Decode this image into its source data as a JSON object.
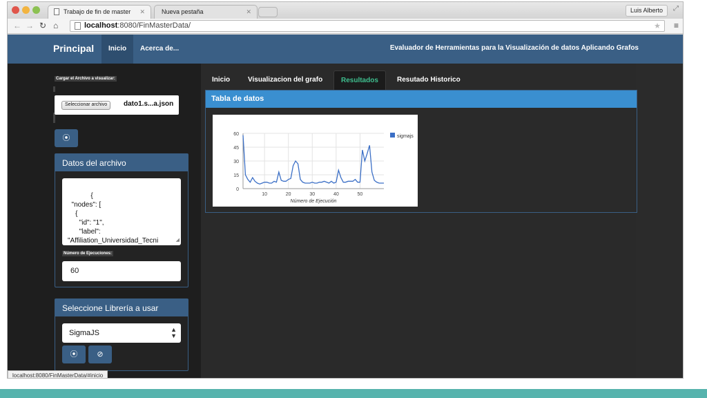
{
  "browser": {
    "tabs": [
      {
        "label": "Trabajo de fin de master"
      },
      {
        "label": "Nueva pestaña"
      }
    ],
    "user": "Luis Alberto",
    "url_host": "localhost",
    "url_rest": ":8080/FinMasterData/",
    "status_url": "localhost:8080/FinMasterData/#inicio"
  },
  "navbar": {
    "brand": "Principal",
    "links": [
      "Inicio",
      "Acerca de..."
    ],
    "title": "Evaluador de Herramientas para la Visualización de datos Aplicando Grafos"
  },
  "sidebar": {
    "upload_label": "Cargar el Archivo a visualizar:",
    "file_button": "Seleccionar archivo",
    "file_name": "dato1.s...a.json",
    "datos_title": "Datos del archivo",
    "json_text": "{\n  \"nodes\": [\n    {\n      \"id\": \"1\",\n      \"label\":\n\"Affiliation_Universidad_Tecni\nca_Particular_de_Loja\"",
    "exec_label": "Número de Ejecuciones:",
    "exec_value": "60",
    "lib_title": "Seleccione Librería a usar",
    "lib_value": "SigmaJS"
  },
  "content": {
    "tabs": [
      "Inicio",
      "Visualizacion del grafo",
      "Resultados",
      "Resutado Historico"
    ],
    "active_tab": "Resultados",
    "panel_title": "Tabla de datos"
  },
  "colors": {
    "navbar": "#3a5f85",
    "accent_tab": "#3fbf8f",
    "panel_head": "#3a8fd0",
    "series": "#3b6fc6"
  },
  "chart_data": {
    "type": "line",
    "xlabel": "Número de Ejecución",
    "ylabel": "",
    "xlim": [
      1,
      60
    ],
    "ylim": [
      0,
      60
    ],
    "xticks": [
      10,
      20,
      30,
      40,
      50
    ],
    "yticks": [
      0,
      15,
      30,
      45,
      60
    ],
    "grid": true,
    "legend": "top-right",
    "series": [
      {
        "name": "sigmajs",
        "x": [
          1,
          2,
          3,
          4,
          5,
          6,
          7,
          8,
          9,
          10,
          11,
          12,
          13,
          14,
          15,
          16,
          17,
          18,
          19,
          20,
          21,
          22,
          23,
          24,
          25,
          26,
          27,
          28,
          29,
          30,
          31,
          32,
          33,
          34,
          35,
          36,
          37,
          38,
          39,
          40,
          41,
          42,
          43,
          44,
          45,
          46,
          47,
          48,
          49,
          50,
          51,
          52,
          53,
          54,
          55,
          56,
          57,
          58,
          59,
          60
        ],
        "values": [
          58,
          15,
          10,
          7,
          12,
          8,
          6,
          5,
          6,
          7,
          7,
          6,
          6,
          8,
          7,
          18,
          9,
          8,
          8,
          10,
          11,
          25,
          30,
          27,
          10,
          7,
          6,
          6,
          6,
          7,
          6,
          6,
          7,
          7,
          8,
          7,
          6,
          8,
          6,
          7,
          20,
          12,
          7,
          7,
          8,
          8,
          8,
          10,
          7,
          7,
          42,
          30,
          38,
          47,
          18,
          9,
          7,
          6,
          6,
          6
        ]
      }
    ]
  }
}
